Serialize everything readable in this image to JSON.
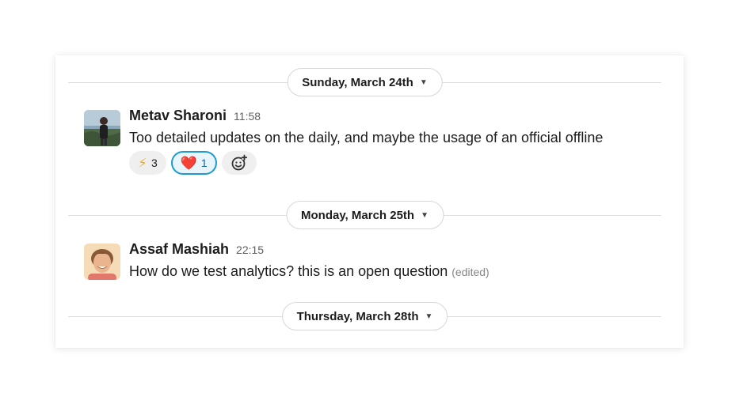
{
  "dividers": [
    {
      "label": "Sunday, March 24th",
      "icon": "chevron-down-icon"
    },
    {
      "label": "Monday, March 25th",
      "icon": "chevron-down-icon"
    },
    {
      "label": "Thursday, March 28th",
      "icon": "chevron-down-icon"
    }
  ],
  "messages": [
    {
      "author": "Metav Sharoni",
      "time": "11:58",
      "text": "Too detailed updates on the daily, and maybe the usage of an official offline",
      "reactions": [
        {
          "emoji": "⚡",
          "count": "3",
          "selected": false
        },
        {
          "emoji": "❤️",
          "count": "1",
          "selected": true
        }
      ],
      "add_reaction_icon": "add-emoji-icon"
    },
    {
      "author": "Assaf Mashiah",
      "time": "22:15",
      "text": "How do we test analytics? this is an open question",
      "edited": "(edited)"
    }
  ],
  "colors": {
    "selected_reaction_border": "#1d9bd1",
    "selected_reaction_bg": "#e8f5fa",
    "divider_line": "#dddddd"
  }
}
